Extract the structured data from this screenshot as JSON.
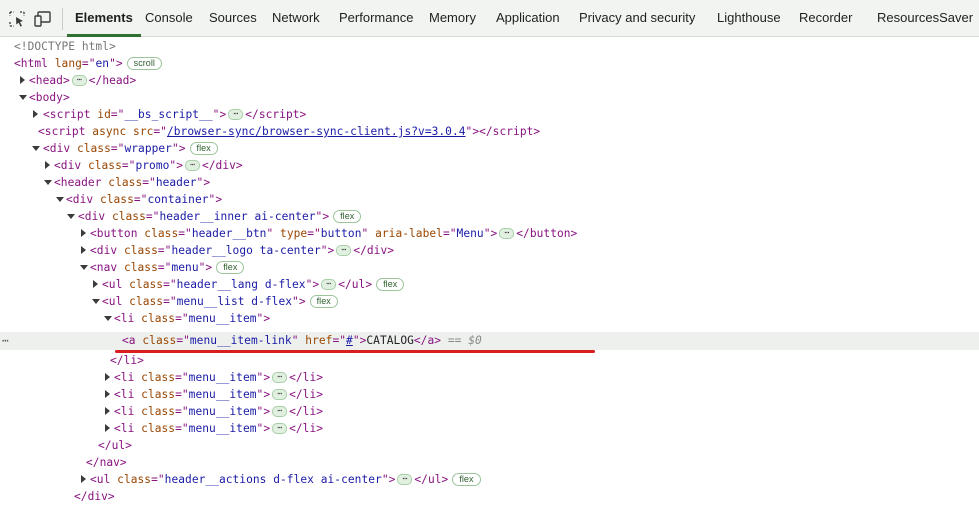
{
  "toolbar": {
    "tabs": [
      {
        "label": "Elements"
      },
      {
        "label": "Console"
      },
      {
        "label": "Sources"
      },
      {
        "label": "Network"
      },
      {
        "label": "Performance"
      },
      {
        "label": "Memory"
      },
      {
        "label": "Application"
      },
      {
        "label": "Privacy and security"
      },
      {
        "label": "Lighthouse"
      },
      {
        "label": "Recorder"
      },
      {
        "label": "ResourcesSaver"
      }
    ],
    "active_tab": "Elements",
    "icons": [
      "select-element-icon",
      "device-toolbar-icon"
    ]
  },
  "tree": {
    "doctype": "<!DOCTYPE html>",
    "html_open": {
      "tag": "html",
      "attr": "lang",
      "val": "en",
      "badge": "scroll"
    },
    "head": {
      "tag": "head"
    },
    "body": {
      "tag": "body"
    },
    "script1": {
      "attr": "id",
      "val": "__bs_script__"
    },
    "script2": {
      "attr1": "async",
      "attr2": "src",
      "val": "/browser-sync/browser-sync-client.js?v=3.0.4"
    },
    "wrapper": {
      "cls": "wrapper",
      "badge": "flex"
    },
    "promo": {
      "cls": "promo"
    },
    "header": {
      "cls": "header"
    },
    "container": {
      "cls": "container"
    },
    "header_inner": {
      "cls": "header__inner ai-center",
      "badge": "flex"
    },
    "button": {
      "cls": "header__btn",
      "type": "button",
      "aria": "Menu"
    },
    "logo": {
      "cls": "header__logo ta-center"
    },
    "nav": {
      "cls": "menu",
      "badge": "flex"
    },
    "lang_ul": {
      "cls": "header__lang d-flex",
      "badge": "flex"
    },
    "menu_ul": {
      "cls": "menu__list d-flex",
      "badge": "flex"
    },
    "menu_item": {
      "cls": "menu__item"
    },
    "selected_link": {
      "cls": "menu__item-link",
      "href": "#",
      "text": "CATALOG",
      "eq": "== $0"
    },
    "li_close": "</li>",
    "ul_close": "</ul>",
    "nav_close": "</nav>",
    "actions_ul": {
      "cls": "header__actions d-flex ai-center",
      "badge": "flex"
    },
    "div_close": "</div>",
    "row_menu": "⋯"
  },
  "colors": {
    "tag": "#881280",
    "attr_name": "#994500",
    "attr_value": "#1a1aa6",
    "active_tab_underline": "#2f6f2f",
    "annotation_underline": "#d81e1e",
    "selected_row_bg": "#eef0ee"
  }
}
